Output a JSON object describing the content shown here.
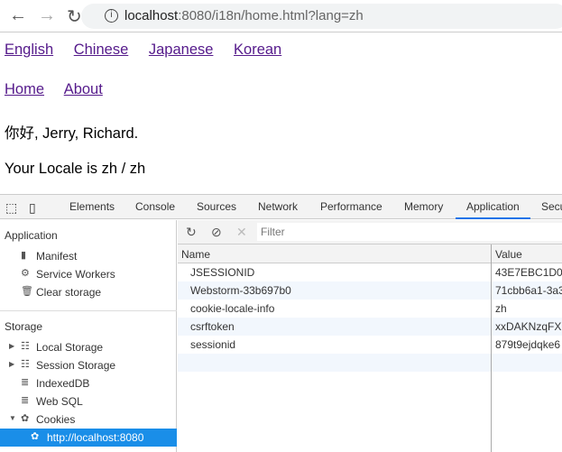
{
  "browser": {
    "url_host": "localhost",
    "url_rest": ":8080/i18n/home.html?lang=zh"
  },
  "page": {
    "languages": [
      "English",
      "Chinese",
      "Japanese",
      "Korean"
    ],
    "nav": [
      "Home",
      "About"
    ],
    "greeting": "你好, Jerry, Richard.",
    "locale": "Your Locale is zh / zh"
  },
  "devtools": {
    "tabs": [
      "Elements",
      "Console",
      "Sources",
      "Network",
      "Performance",
      "Memory",
      "Application",
      "Secu"
    ],
    "active_tab": "Application",
    "sidebar": {
      "app_header": "Application",
      "app_items": [
        "Manifest",
        "Service Workers",
        "Clear storage"
      ],
      "storage_header": "Storage",
      "storage_items": [
        "Local Storage",
        "Session Storage",
        "IndexedDB",
        "Web SQL",
        "Cookies"
      ],
      "selected": "http://localhost:8080"
    },
    "filter_placeholder": "Filter",
    "columns": [
      "Name",
      "Value"
    ],
    "cookies": [
      {
        "name": "JSESSIONID",
        "value": "43E7EBC1D0"
      },
      {
        "name": "Webstorm-33b697b0",
        "value": "71cbb6a1-3a3"
      },
      {
        "name": "cookie-locale-info",
        "value": "zh"
      },
      {
        "name": "csrftoken",
        "value": "xxDAKNzqFX"
      },
      {
        "name": "sessionid",
        "value": "879t9ejdqke6"
      }
    ],
    "accent": "#1a8ee8"
  }
}
